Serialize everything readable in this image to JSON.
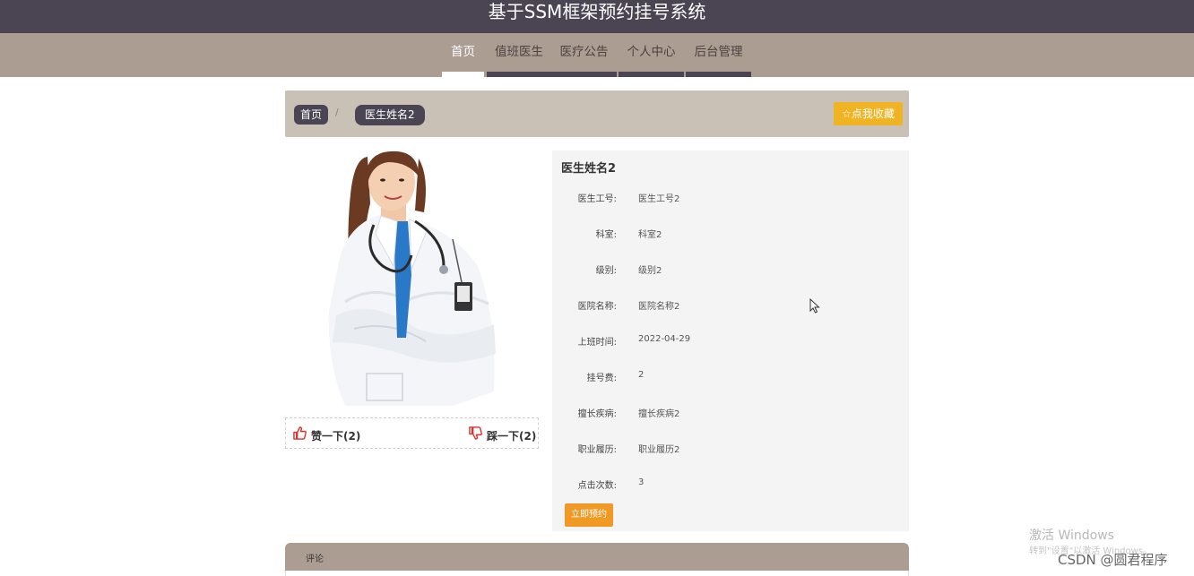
{
  "site_title": "基于SSM框架预约挂号系统",
  "nav": [
    {
      "label": "首页",
      "active": true
    },
    {
      "label": "值班医生",
      "active": false
    },
    {
      "label": "医疗公告",
      "active": false
    },
    {
      "label": "个人中心",
      "active": false
    },
    {
      "label": "后台管理",
      "active": false
    }
  ],
  "breadcrumb": {
    "home": "首页",
    "separator": "/",
    "current": "医生姓名2"
  },
  "favorite_button": "☆点我收藏",
  "votes": {
    "up_label": "赞一下(2)",
    "down_label": "踩一下(2)"
  },
  "doctor": {
    "name": "医生姓名2",
    "fields": [
      {
        "label": "医生工号:",
        "value": "医生工号2"
      },
      {
        "label": "科室:",
        "value": "科室2"
      },
      {
        "label": "级别:",
        "value": "级别2"
      },
      {
        "label": "医院名称:",
        "value": "医院名称2"
      },
      {
        "label": "上班时间:",
        "value": "2022-04-29"
      },
      {
        "label": "挂号费:",
        "value": "2"
      },
      {
        "label": "擅长疾病:",
        "value": "擅长疾病2"
      },
      {
        "label": "职业履历:",
        "value": "职业履历2"
      },
      {
        "label": "点击次数:",
        "value": "3"
      }
    ],
    "book_button": "立即预约"
  },
  "comments": {
    "title": "评论"
  },
  "watermark": {
    "activate": "激活 Windows",
    "activate_sub": "转到\"设置\"以激活 Windows。",
    "csdn": "CSDN @圆君程序"
  },
  "colors": {
    "header_dark": "#4b4453",
    "nav_bar": "#ac9d93",
    "breadcrumb_bg": "#c9c0b6",
    "favorite_yellow": "#f0b323",
    "book_orange": "#f09a25",
    "info_bg": "#f4f4f4"
  }
}
